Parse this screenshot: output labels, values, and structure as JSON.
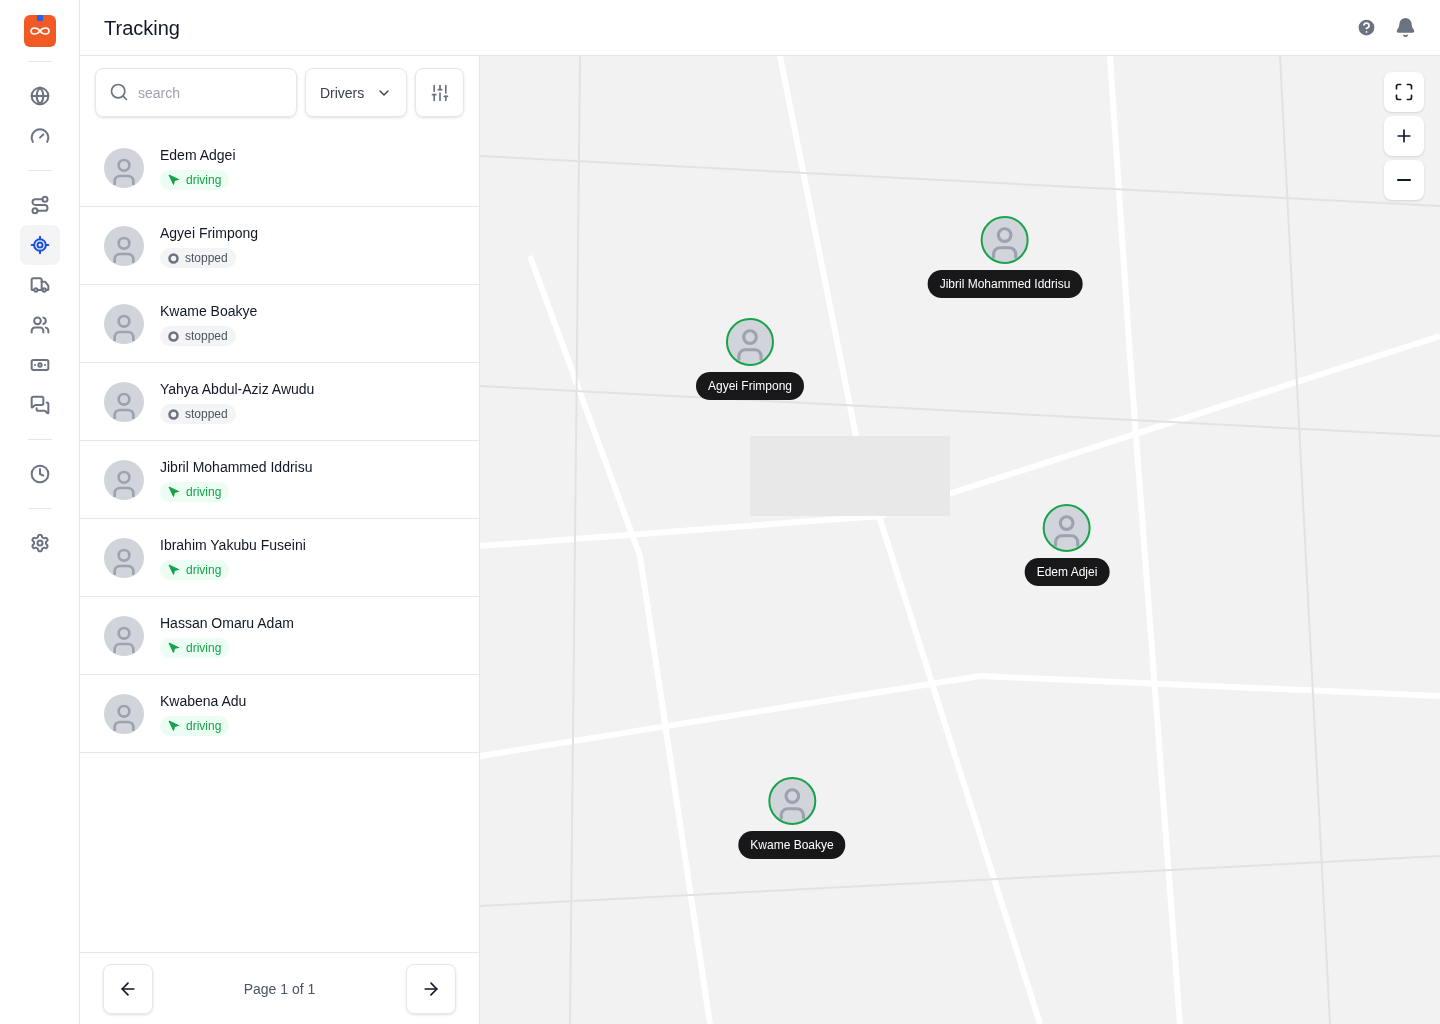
{
  "header": {
    "title": "Tracking"
  },
  "nav_groups": [
    [
      {
        "selected": false
      },
      {
        "selected": false
      }
    ],
    [
      {
        "selected": false
      },
      {
        "selected": true
      },
      {
        "selected": false
      },
      {
        "selected": false
      },
      {
        "selected": false
      },
      {
        "selected": false
      }
    ],
    [
      {
        "selected": false
      }
    ],
    [
      {
        "selected": false
      }
    ]
  ],
  "search": {
    "placeholder": "search"
  },
  "filter": {
    "value": "Drivers"
  },
  "drivers": [
    {
      "name": "Edem Adgei",
      "status": "driving",
      "kind": "driving"
    },
    {
      "name": "Agyei Frimpong",
      "status": "stopped",
      "kind": "stopped"
    },
    {
      "name": "Kwame Boakye",
      "status": "stopped",
      "kind": "stopped"
    },
    {
      "name": "Yahya Abdul-Aziz Awudu",
      "status": "stopped",
      "kind": "stopped"
    },
    {
      "name": "Jibril Mohammed Iddrisu",
      "status": "driving",
      "kind": "driving"
    },
    {
      "name": "Ibrahim Yakubu Fuseini",
      "status": "driving",
      "kind": "driving"
    },
    {
      "name": "Hassan Omaru Adam",
      "status": "driving",
      "kind": "driving"
    },
    {
      "name": "Kwabena Adu",
      "status": "driving",
      "kind": "driving"
    }
  ],
  "pagination": {
    "label": "Page 1 of 1"
  },
  "map": {
    "markers": [
      {
        "label": "Jibril Mohammed Iddrisu"
      },
      {
        "label": "Agyei Frimpong"
      },
      {
        "label": "Edem Adjei"
      },
      {
        "label": "Kwame Boakye"
      }
    ]
  }
}
